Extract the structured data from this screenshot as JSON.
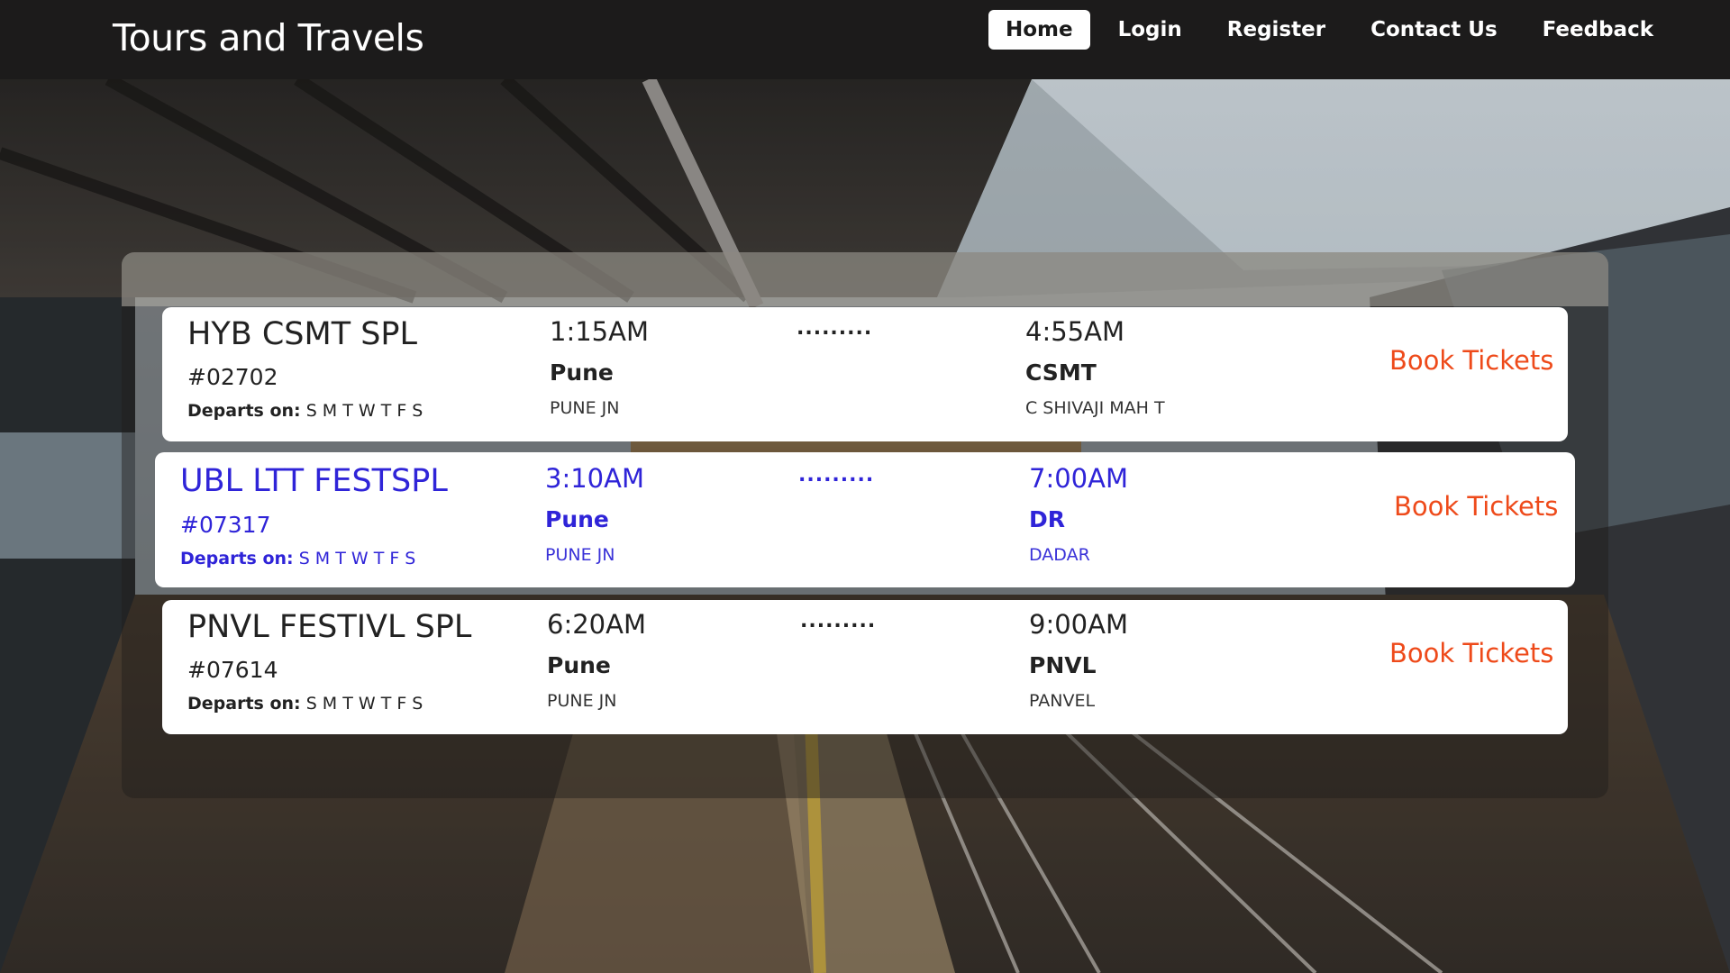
{
  "navbar": {
    "brand": "Tours and Travels",
    "items": [
      {
        "label": "Home",
        "active": true
      },
      {
        "label": "Login",
        "active": false
      },
      {
        "label": "Register",
        "active": false
      },
      {
        "label": "Contact Us",
        "active": false
      },
      {
        "label": "Feedback",
        "active": false
      }
    ]
  },
  "colors": {
    "navbar_bg": "#1c1b1b",
    "book_link": "#ee4a1a",
    "hover_text": "#2f24d8"
  },
  "trains": [
    {
      "name": "HYB CSMT SPL",
      "number": "#02702",
      "departs_label": "Departs on:",
      "days": "S M T W T F S",
      "dep_time": "1:15AM",
      "dep_code": "Pune",
      "dep_station": "PUNE JN",
      "separator": ".........",
      "arr_time": "4:55AM",
      "arr_code": "CSMT",
      "arr_station": "C SHIVAJI MAH T",
      "book_label": "Book Tickets"
    },
    {
      "name": "UBL LTT FESTSPL",
      "number": "#07317",
      "departs_label": "Departs on:",
      "days": "S M T W T F S",
      "dep_time": "3:10AM",
      "dep_code": "Pune",
      "dep_station": "PUNE JN",
      "separator": ".........",
      "arr_time": "7:00AM",
      "arr_code": "DR",
      "arr_station": "DADAR",
      "book_label": "Book Tickets"
    },
    {
      "name": "PNVL FESTIVL SPL",
      "number": "#07614",
      "departs_label": "Departs on:",
      "days": "S M T W T F S",
      "dep_time": "6:20AM",
      "dep_code": "Pune",
      "dep_station": "PUNE JN",
      "separator": ".........",
      "arr_time": "9:00AM",
      "arr_code": "PNVL",
      "arr_station": "PANVEL",
      "book_label": "Book Tickets"
    }
  ]
}
